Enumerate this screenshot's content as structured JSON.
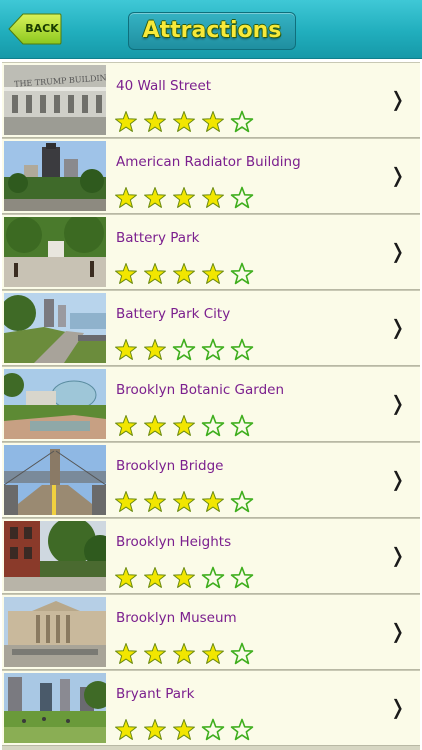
{
  "header": {
    "back_label": "BACK",
    "title": "Attractions"
  },
  "colors": {
    "star_filled": "#f2e600",
    "star_outline": "#3fae1e",
    "name_text": "#7b1f8e"
  },
  "items": [
    {
      "name": "40 Wall Street",
      "rating": 4,
      "thumb_icon": "building-photo"
    },
    {
      "name": "American Radiator Building",
      "rating": 4,
      "thumb_icon": "skyline-photo"
    },
    {
      "name": "Battery Park",
      "rating": 4,
      "thumb_icon": "park-photo"
    },
    {
      "name": "Battery Park City",
      "rating": 2,
      "thumb_icon": "waterfront-photo"
    },
    {
      "name": "Brooklyn Botanic Garden",
      "rating": 3,
      "thumb_icon": "garden-photo"
    },
    {
      "name": "Brooklyn Bridge",
      "rating": 4,
      "thumb_icon": "bridge-photo"
    },
    {
      "name": "Brooklyn Heights",
      "rating": 3,
      "thumb_icon": "street-photo"
    },
    {
      "name": "Brooklyn Museum",
      "rating": 4,
      "thumb_icon": "museum-photo"
    },
    {
      "name": "Bryant Park",
      "rating": 3,
      "thumb_icon": "plaza-photo"
    }
  ]
}
